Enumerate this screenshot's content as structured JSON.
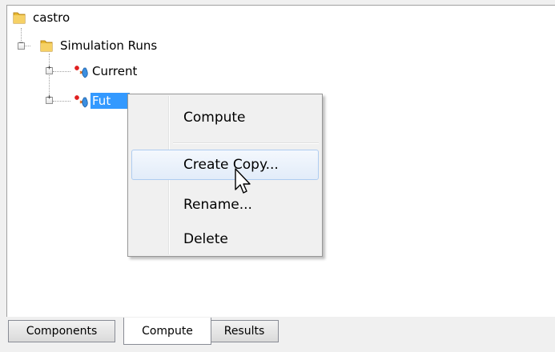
{
  "tree": {
    "root": {
      "label": "castro",
      "icon": "folder-icon"
    },
    "children": [
      {
        "label": "Simulation Runs",
        "icon": "folder-icon",
        "expander": "−",
        "children": [
          {
            "label": "Current",
            "icon": "simulation-run-icon",
            "expander": "+"
          },
          {
            "label": "Fut",
            "icon": "simulation-run-icon",
            "expander": "+",
            "selected": true
          }
        ]
      }
    ]
  },
  "context_menu": {
    "items": [
      {
        "label": "Compute"
      },
      {
        "label": "Create Copy...",
        "hover": true
      },
      {
        "label": "Rename..."
      },
      {
        "label": "Delete"
      }
    ]
  },
  "tabs": [
    {
      "label": "Components",
      "active": false
    },
    {
      "label": "Compute",
      "active": true
    },
    {
      "label": "Results",
      "active": false
    }
  ],
  "colors": {
    "selection": "#3399ff",
    "menu_hover_border": "#aeccf1",
    "folder": "#e8b830"
  }
}
